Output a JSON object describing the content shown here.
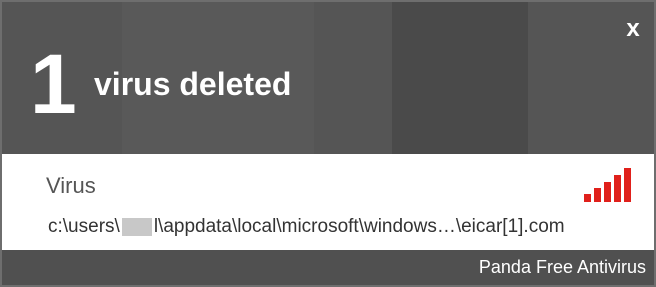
{
  "notification": {
    "count": "1",
    "headline": "virus deleted",
    "close_symbol": "x"
  },
  "threat": {
    "type": "Virus",
    "path_start": "c:\\users\\",
    "path_end": "l\\appdata\\local\\microsoft\\windows…\\eicar[1].com",
    "severity_icon": "signal-bars-icon",
    "severity_level": 5,
    "severity_max": 5,
    "severity_color": "#e0201b"
  },
  "footer": {
    "brand": "Panda Free Antivirus"
  },
  "colors": {
    "header_background": "#555555",
    "footer_background": "#505050",
    "body_background": "#ffffff"
  }
}
